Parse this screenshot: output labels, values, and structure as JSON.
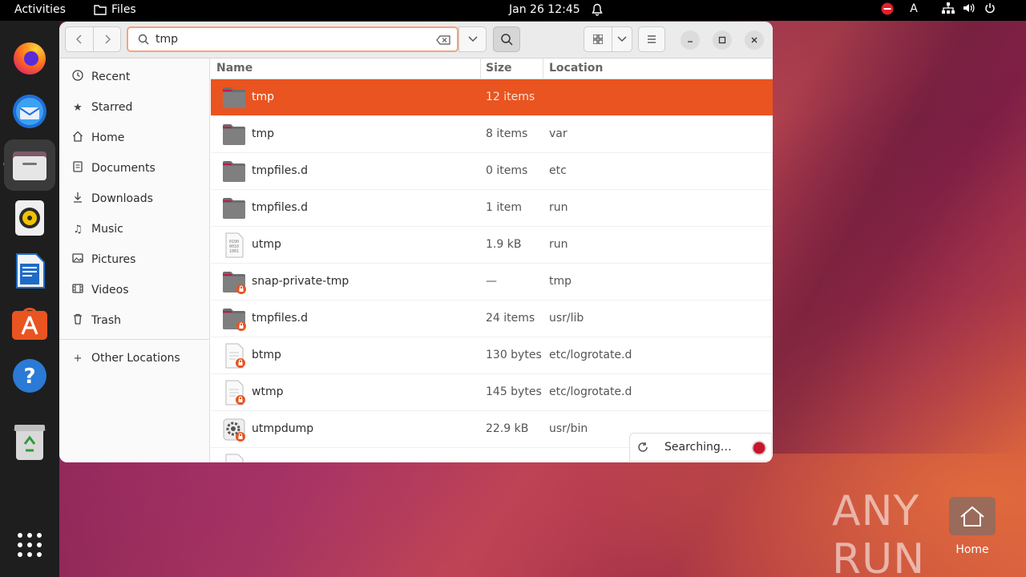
{
  "topbar": {
    "activities": "Activities",
    "app_name": "Files",
    "clock": "Jan 26  12:45",
    "input_indicator": "A"
  },
  "dock": {
    "items": [
      "firefox-icon",
      "thunderbird-icon",
      "files-icon",
      "rhythmbox-icon",
      "libreoffice-writer-icon",
      "app-center-icon",
      "help-icon",
      "trash-icon",
      "show-apps-icon"
    ]
  },
  "window": {
    "search_value": "tmp",
    "sidebar": {
      "items": [
        {
          "label": "Recent",
          "icon": "clock-icon"
        },
        {
          "label": "Starred",
          "icon": "star-icon"
        },
        {
          "label": "Home",
          "icon": "home-icon"
        },
        {
          "label": "Documents",
          "icon": "document-icon"
        },
        {
          "label": "Downloads",
          "icon": "download-icon"
        },
        {
          "label": "Music",
          "icon": "music-icon"
        },
        {
          "label": "Pictures",
          "icon": "pictures-icon"
        },
        {
          "label": "Videos",
          "icon": "videos-icon"
        },
        {
          "label": "Trash",
          "icon": "trash-icon"
        }
      ],
      "other": "Other Locations"
    },
    "columns": {
      "name": "Name",
      "size": "Size",
      "location": "Location"
    },
    "rows": [
      {
        "name": "tmp",
        "size": "12 items",
        "location": "",
        "type": "folder"
      },
      {
        "name": "tmp",
        "size": "8 items",
        "location": "var",
        "type": "folder"
      },
      {
        "name": "tmpfiles.d",
        "size": "0 items",
        "location": "etc",
        "type": "folder"
      },
      {
        "name": "tmpfiles.d",
        "size": "1 item",
        "location": "run",
        "type": "folder"
      },
      {
        "name": "utmp",
        "size": "1.9 kB",
        "location": "run",
        "type": "binary"
      },
      {
        "name": "snap-private-tmp",
        "size": "—",
        "location": "tmp",
        "type": "folder-locked"
      },
      {
        "name": "tmpfiles.d",
        "size": "24 items",
        "location": "usr/lib",
        "type": "folder-locked"
      },
      {
        "name": "btmp",
        "size": "130 bytes",
        "location": "etc/logrotate.d",
        "type": "file-locked"
      },
      {
        "name": "wtmp",
        "size": "145 bytes",
        "location": "etc/logrotate.d",
        "type": "file-locked"
      },
      {
        "name": "utmpdump",
        "size": "22.9 kB",
        "location": "usr/bin",
        "type": "exec-locked"
      }
    ],
    "searching": "Searching…"
  },
  "desktop": {
    "home_label": "Home",
    "watermark": "ANY RUN"
  },
  "colors": {
    "accent": "#e95420",
    "dock": "#1e1e1e"
  }
}
